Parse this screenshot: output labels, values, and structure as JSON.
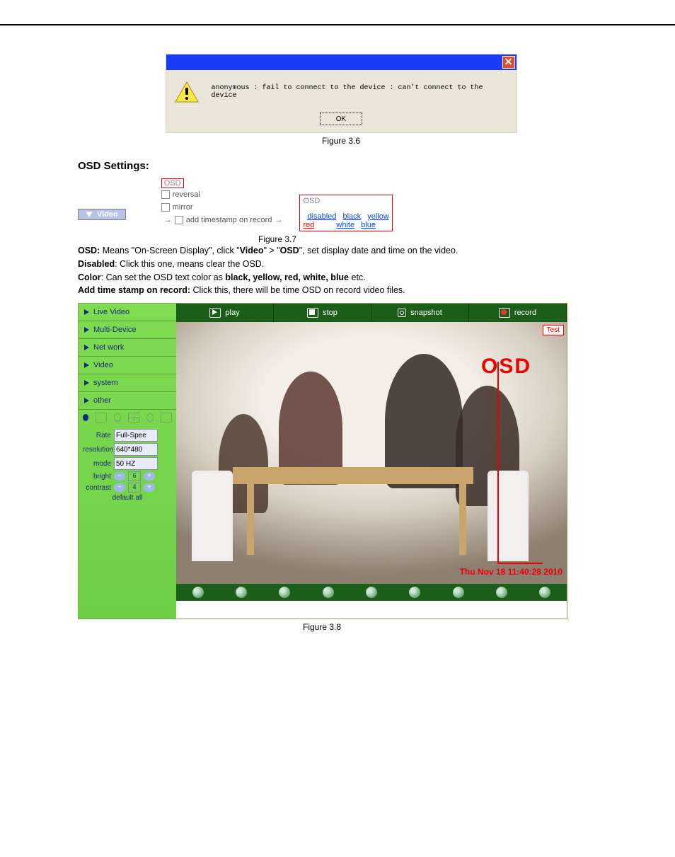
{
  "dialog": {
    "close_glyph": "✕",
    "message": "anonymous : fail to connect to the device : can't connect to the device",
    "ok_label": "OK"
  },
  "captions": {
    "fig36": "Figure 3.6",
    "fig37": "Figure 3.7",
    "fig38": "Figure 3.8"
  },
  "heading": {
    "osd_settings": "OSD Settings",
    "colon": ":"
  },
  "settings": {
    "osd_title": "OSD",
    "reversal": "reversal",
    "mirror": "mirror",
    "add_ts": "add timestamp on record",
    "video_tab": "Video",
    "color_popup_title": "OSD",
    "colors": {
      "disabled": "disabled",
      "black": "black",
      "yellow": "yellow",
      "red": "red",
      "white": "white",
      "blue": "blue"
    }
  },
  "paragraphs": {
    "p1_b1": "OSD:",
    "p1_txt1": " Means \"On-Screen Display\", click \"",
    "p1_b2": "Video",
    "p1_txt2": "\" > \"",
    "p1_b3": "OSD",
    "p1_txt3": "\", set display date and time on the video.",
    "p2_b": "Disabled",
    "p2_txt": ": Click this one, means clear the OSD.",
    "p3_b1": "Color",
    "p3_txt1": ": Can set the OSD text color as ",
    "p3_b2": "black, yellow, red, white, blue",
    "p3_txt2": " etc.",
    "p4_b": "Add time stamp on record:",
    "p4_txt": " Click this, there will be time OSD on record video files."
  },
  "app": {
    "nav": [
      {
        "label": "Live Video"
      },
      {
        "label": "Multi-Device"
      },
      {
        "label": "Net work"
      },
      {
        "label": "Video"
      },
      {
        "label": "system"
      },
      {
        "label": "other"
      }
    ],
    "controls": {
      "rate_label": "Rate",
      "rate_value": "Full-Spee",
      "resolution_label": "resolution",
      "resolution_value": "640*480",
      "mode_label": "mode",
      "mode_value": "50 HZ",
      "bright_label": "bright",
      "bright_value": "6",
      "contrast_label": "contrast",
      "contrast_value": "4",
      "default_all": "default all"
    },
    "functions": {
      "play": "play",
      "stop": "stop",
      "snapshot": "snapshot",
      "record": "record"
    },
    "overlays": {
      "test": "Test",
      "osd": "OSD",
      "timestamp": "Thu Nov 18 11:40:28 2010"
    }
  }
}
